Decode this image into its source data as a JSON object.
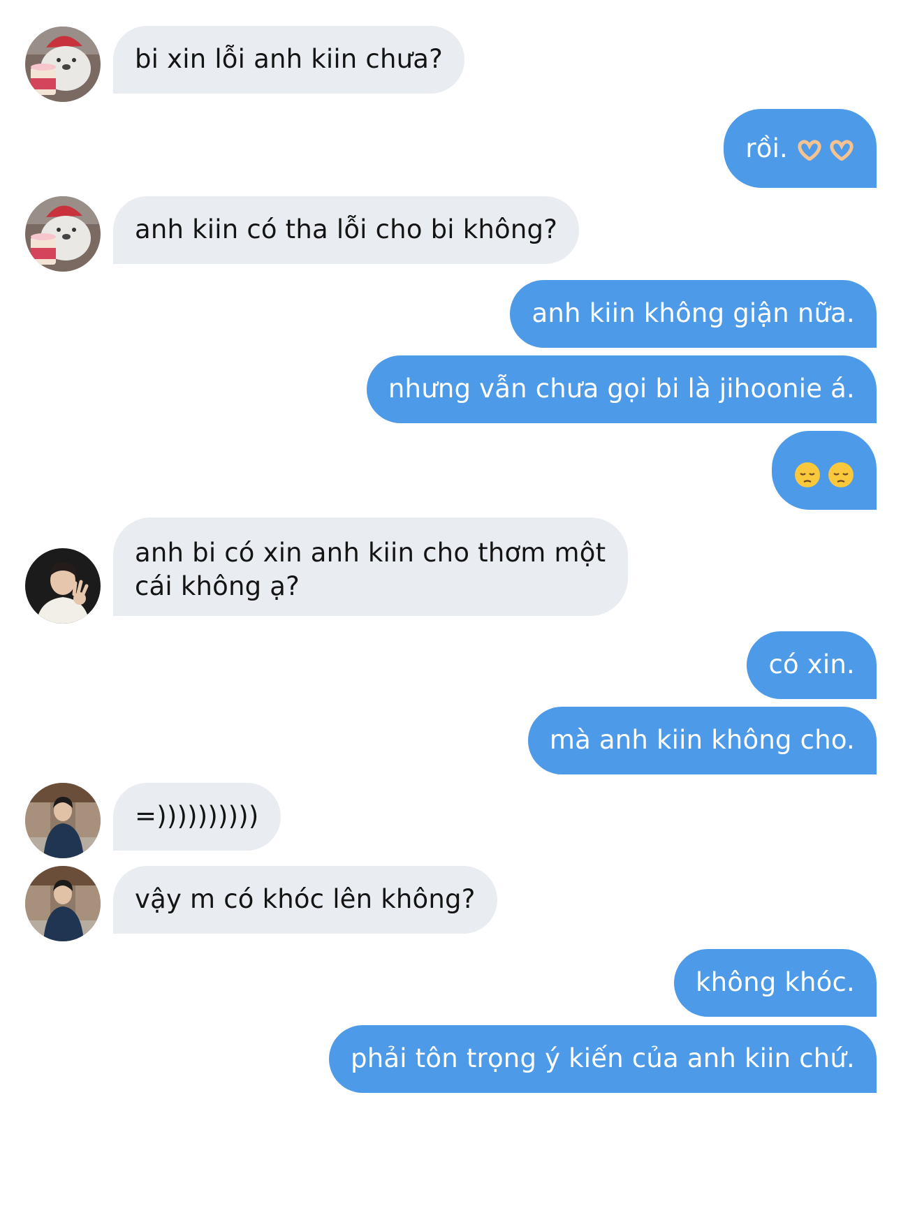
{
  "chat": {
    "messages": [
      {
        "id": 0,
        "side": "in",
        "text": "bi xin lỗi anh kiin chưa?",
        "avatar": "bear-icecream-avatar"
      },
      {
        "id": 1,
        "side": "out",
        "text": "rồi.",
        "emoji": "heart-hands-icon x2"
      },
      {
        "id": 2,
        "side": "in",
        "text": "anh kiin có tha lỗi cho bi không?",
        "avatar": "bear-icecream-avatar"
      },
      {
        "id": 3,
        "side": "out",
        "text": "anh kiin không giận nữa."
      },
      {
        "id": 4,
        "side": "out",
        "text": "nhưng vẫn chưa gọi bi là jihoonie á."
      },
      {
        "id": 5,
        "side": "out",
        "text": "",
        "emoji": "pensive-face-icon x2"
      },
      {
        "id": 6,
        "side": "in",
        "text": "anh bi có xin anh kiin cho thơm một cái không ạ?",
        "avatar": "man-claw-pose-avatar"
      },
      {
        "id": 7,
        "side": "out",
        "text": "có xin."
      },
      {
        "id": 8,
        "side": "out",
        "text": "mà anh kiin không cho."
      },
      {
        "id": 9,
        "side": "in",
        "text": "=))))))))))",
        "avatar": "man-street-avatar"
      },
      {
        "id": 10,
        "side": "in",
        "text": "vậy m có khóc lên không?",
        "avatar": "man-street-avatar"
      },
      {
        "id": 11,
        "side": "out",
        "text": "không khóc."
      },
      {
        "id": 12,
        "side": "out",
        "text": "phải tôn trọng ý kiến của anh kiin chứ."
      }
    ]
  },
  "colors": {
    "incoming_bubble": "#e9ecf0",
    "outgoing_bubble": "#4d9be8",
    "incoming_text": "#141414",
    "outgoing_text": "#ffffff"
  }
}
